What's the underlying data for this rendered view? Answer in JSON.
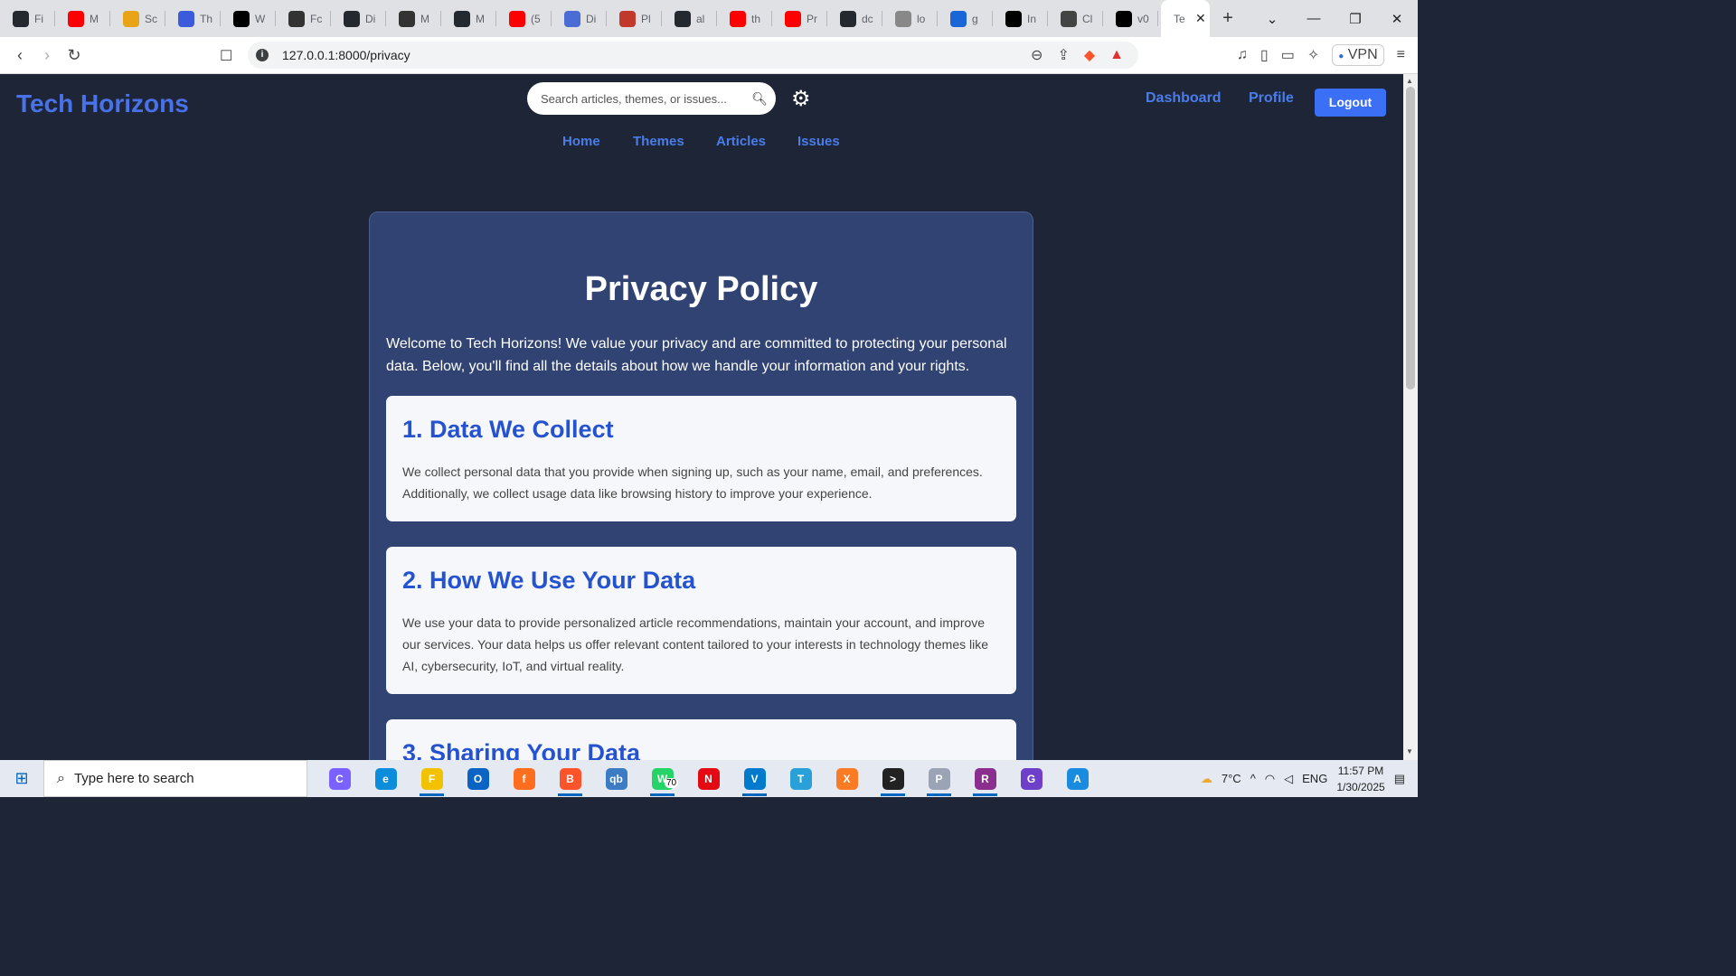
{
  "browser": {
    "tabs": [
      {
        "label": "Fi",
        "icon": "github-icon",
        "color": "#24292f"
      },
      {
        "label": "M",
        "icon": "youtube-icon",
        "color": "#ff0000"
      },
      {
        "label": "Sc",
        "icon": "sc-icon",
        "color": "#e8a317"
      },
      {
        "label": "Th",
        "icon": "power-icon",
        "color": "#3b5bdb"
      },
      {
        "label": "W",
        "icon": "m-icon",
        "color": "#000000"
      },
      {
        "label": "Fc",
        "icon": "openai-icon",
        "color": "#333333"
      },
      {
        "label": "Di",
        "icon": "github-icon",
        "color": "#24292f"
      },
      {
        "label": "M",
        "icon": "profile-icon",
        "color": "#333333"
      },
      {
        "label": "M",
        "icon": "github-icon",
        "color": "#24292f"
      },
      {
        "label": "(5",
        "icon": "youtube-icon",
        "color": "#ff0000"
      },
      {
        "label": "Di",
        "icon": "bird-icon",
        "color": "#4a6cd4"
      },
      {
        "label": "Pl",
        "icon": "game-icon",
        "color": "#c0392b"
      },
      {
        "label": "al",
        "icon": "github-icon",
        "color": "#24292f"
      },
      {
        "label": "th",
        "icon": "youtube-icon",
        "color": "#ff0000"
      },
      {
        "label": "Pr",
        "icon": "youtube-icon",
        "color": "#ff0000"
      },
      {
        "label": "dc",
        "icon": "github-icon",
        "color": "#24292f"
      },
      {
        "label": "lo",
        "icon": "mountain-icon",
        "color": "#888888"
      },
      {
        "label": "g",
        "icon": "w-icon",
        "color": "#1a66d6"
      },
      {
        "label": "In",
        "icon": "openai-icon",
        "color": "#000000"
      },
      {
        "label": "Cl",
        "icon": "openai-icon",
        "color": "#444444"
      },
      {
        "label": "v0",
        "icon": "v0-icon",
        "color": "#000000"
      }
    ],
    "active_tab": {
      "label": "Te"
    },
    "url": "127.0.0.1:8000/privacy",
    "vpn_label": "VPN"
  },
  "site": {
    "logo": "Tech Horizons",
    "search_placeholder": "Search articles, themes, or issues...",
    "top_links": [
      "Dashboard",
      "Profile"
    ],
    "logout": "Logout",
    "nav": [
      "Home",
      "Themes",
      "Articles",
      "Issues"
    ],
    "colors": {
      "accent": "#4a7de8",
      "background": "#1e2537",
      "card": "#314372",
      "heading": "#2553cf"
    }
  },
  "policy": {
    "title": "Privacy Policy",
    "intro": "Welcome to Tech Horizons! We value your privacy and are committed to protecting your personal data. Below, you'll find all the details about how we handle your information and your rights.",
    "sections": [
      {
        "heading": "1. Data We Collect",
        "body": "We collect personal data that you provide when signing up, such as your name, email, and preferences. Additionally, we collect usage data like browsing history to improve your experience."
      },
      {
        "heading": "2. How We Use Your Data",
        "body": "We use your data to provide personalized article recommendations, maintain your account, and improve our services. Your data helps us offer relevant content tailored to your interests in technology themes like AI, cybersecurity, IoT, and virtual reality."
      },
      {
        "heading": "3. Sharing Your Data",
        "body": ""
      }
    ]
  },
  "taskbar": {
    "search_placeholder": "Type here to search",
    "apps": [
      {
        "name": "copilot-icon",
        "glyph": "C",
        "color": "#7b61ff"
      },
      {
        "name": "edge-icon",
        "glyph": "e",
        "color": "#0c8ddb"
      },
      {
        "name": "file-explorer-icon",
        "glyph": "F",
        "color": "#f2c200"
      },
      {
        "name": "outlook-icon",
        "glyph": "O",
        "color": "#0a64c4"
      },
      {
        "name": "firefox-icon",
        "glyph": "f",
        "color": "#ff6d1f"
      },
      {
        "name": "brave-icon",
        "glyph": "B",
        "color": "#fb542b"
      },
      {
        "name": "qbittorrent-icon",
        "glyph": "qb",
        "color": "#3c7cc4"
      },
      {
        "name": "whatsapp-icon",
        "glyph": "W",
        "color": "#25d366"
      },
      {
        "name": "netflix-icon",
        "glyph": "N",
        "color": "#e50914"
      },
      {
        "name": "vscode-icon",
        "glyph": "V",
        "color": "#007acc"
      },
      {
        "name": "telegram-icon",
        "glyph": "T",
        "color": "#2aa0d9"
      },
      {
        "name": "xampp-icon",
        "glyph": "X",
        "color": "#fb7a24"
      },
      {
        "name": "terminal-icon",
        "glyph": ">",
        "color": "#222222"
      },
      {
        "name": "photos-icon",
        "glyph": "P",
        "color": "#9aa4b4"
      },
      {
        "name": "winrar-icon",
        "glyph": "R",
        "color": "#8b2f8f"
      },
      {
        "name": "github-desktop-icon",
        "glyph": "G",
        "color": "#6e40c9"
      },
      {
        "name": "paint-icon",
        "glyph": "A",
        "color": "#1a8ce0"
      }
    ],
    "whatsapp_badge": "70",
    "weather": "7°C",
    "language": "ENG",
    "time": "11:57 PM",
    "date": "1/30/2025"
  }
}
